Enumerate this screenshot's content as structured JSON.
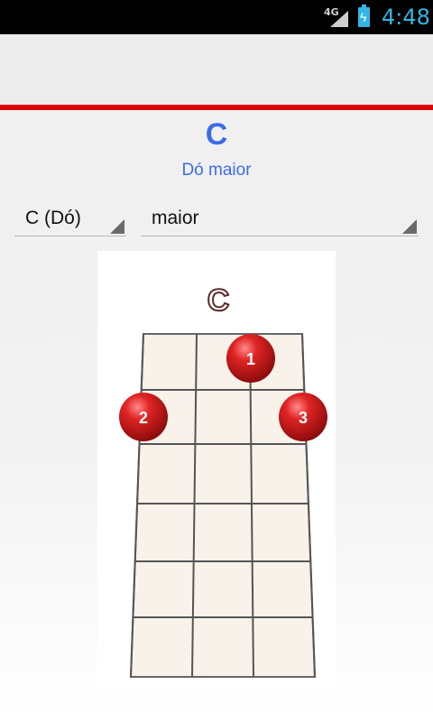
{
  "status_bar": {
    "network": "4G",
    "time": "4:48",
    "icons": [
      "signal-icon",
      "battery-charging-icon"
    ]
  },
  "chord": {
    "name": "C",
    "full_name": "Dó maior"
  },
  "selectors": {
    "root": "C (Dó)",
    "type": "maior"
  },
  "diagram": {
    "label": "C",
    "fingers": [
      {
        "number": "1",
        "string": 3,
        "fret": 1
      },
      {
        "number": "2",
        "string": 1,
        "fret": 2
      },
      {
        "number": "3",
        "string": 4,
        "fret": 2
      }
    ]
  },
  "colors": {
    "accent": "#3d6ce8",
    "divider": "#dd0000",
    "finger": "#d81e1e"
  }
}
